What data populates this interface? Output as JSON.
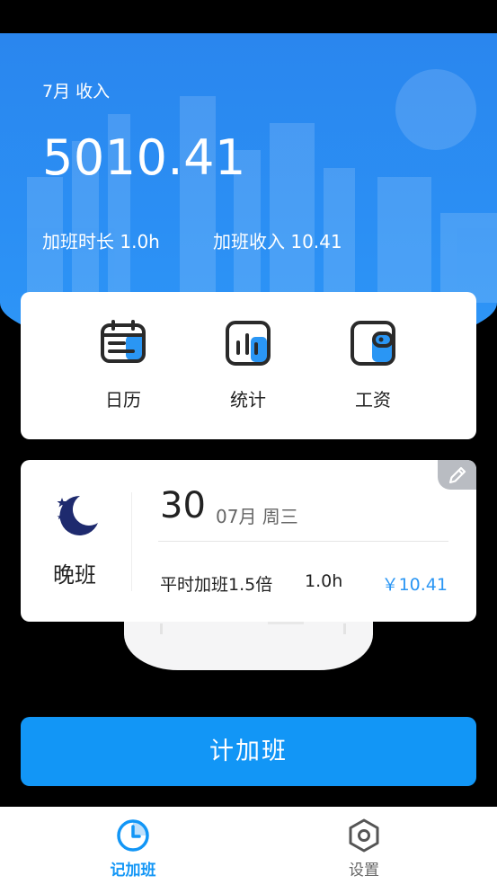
{
  "summary": {
    "month_label": "7月 收入",
    "income_value": "5010.41",
    "ot_duration": "加班时长  1.0h",
    "ot_income": "加班收入  10.41"
  },
  "menu": {
    "items": [
      {
        "label": "日历",
        "icon": "calendar-icon"
      },
      {
        "label": "统计",
        "icon": "chart-icon"
      },
      {
        "label": "工资",
        "icon": "wallet-icon"
      }
    ]
  },
  "record": {
    "shift": "晚班",
    "day": "30",
    "date_meta": "07月 周三",
    "ot_type": "平时加班1.5倍",
    "hours": "1.0h",
    "amount": "￥10.41"
  },
  "actions": {
    "record_label": "计加班"
  },
  "nav": {
    "tabs": [
      {
        "label": "记加班",
        "icon": "clock-icon",
        "active": true
      },
      {
        "label": "设置",
        "icon": "settings-icon",
        "active": false
      }
    ]
  },
  "colors": {
    "brand_blue": "#1296f6",
    "header_blue": "#2b8ff4",
    "moon_navy": "#1e2a6e"
  }
}
